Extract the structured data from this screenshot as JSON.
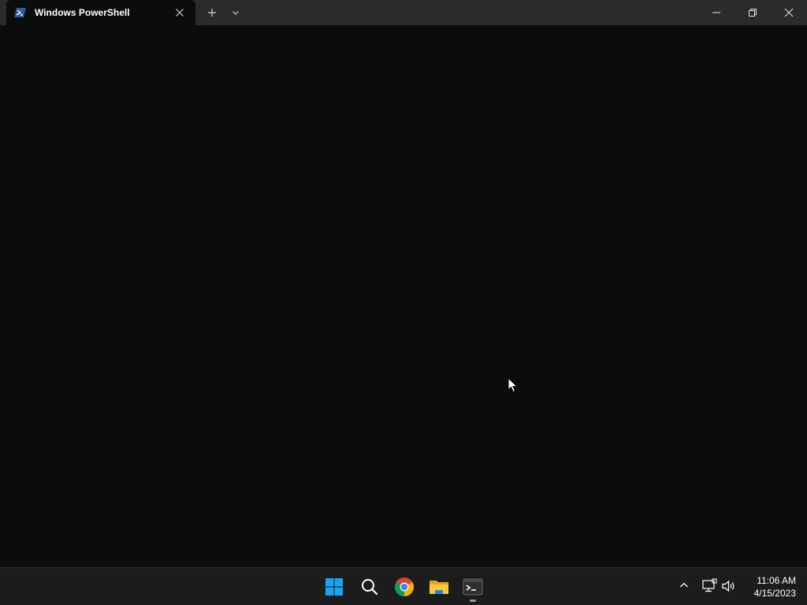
{
  "window": {
    "tab_title": "Windows PowerShell",
    "tab_icon": "powershell-icon",
    "accent": "#2c5aa0"
  },
  "taskbar": {
    "apps": [
      "start-icon",
      "search-icon",
      "chrome-icon",
      "file-explorer-icon",
      "terminal-icon"
    ],
    "clock": {
      "time": "11:06 AM",
      "date": "4/15/2023"
    }
  }
}
